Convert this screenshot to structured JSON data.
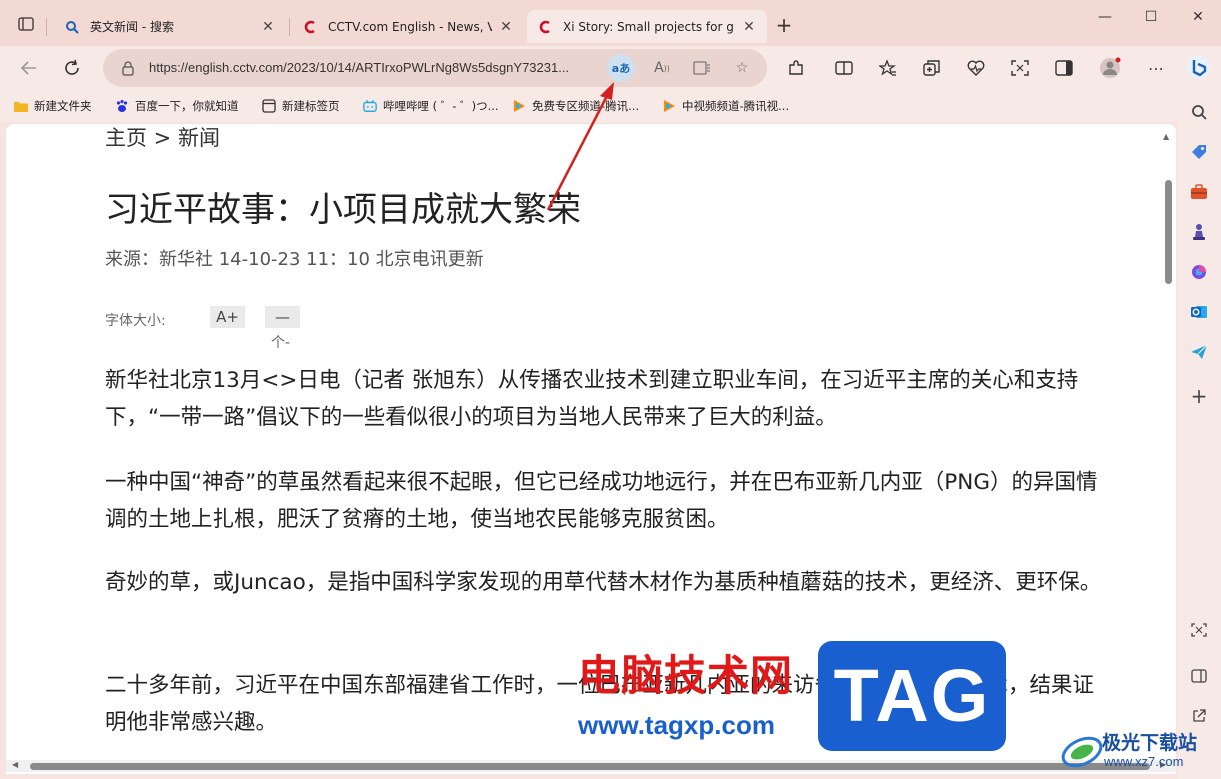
{
  "tabs": [
    {
      "title": "英文新闻 - 搜索",
      "favicon": "search-icon",
      "active": false
    },
    {
      "title": "CCTV.com English - News, Video",
      "favicon": "cctv-logo-icon",
      "active": false
    },
    {
      "title": "Xi Story: Small projects for greate",
      "favicon": "cctv-logo-icon",
      "active": true
    }
  ],
  "toolbar": {
    "url": "https://english.cctv.com/2023/10/14/ARTIrxoPWLrNg8Ws5dsgnY73231...",
    "translate_label": "aあ"
  },
  "bookmarks": [
    "新建文件夹",
    "百度一下，你就知道",
    "新建标签页",
    "哔哩哔哩 ( ゜- ゜)つ...",
    "免费专区频道-腾讯...",
    "中视频频道-腾讯视..."
  ],
  "article": {
    "breadcrumb": "主页 > 新闻",
    "title": "习近平故事：小项目成就大繁荣",
    "source": "来源：新华社 14-10-23 11：10 北京电讯更新",
    "font_size_label": "字体大小:",
    "font_increase": "A+",
    "font_decrease": "—",
    "font_hint": "个-",
    "paragraphs": [
      "新华社北京13月<>日电（记者 张旭东）从传播农业技术到建立职业车间，在习近平主席的关心和支持下，“一带一路”倡议下的一些看似很小的项目为当地人民带来了巨大的利益。",
      "一种中国“神奇”的草虽然看起来很不起眼，但它已经成功地远行，并在巴布亚新几内亚（PNG）的异国情调的土地上扎根，肥沃了贫瘠的土地，使当地农民能够克服贫困。",
      "奇妙的草，或Juncao，是指中国科学家发现的用草代替木材作为基质种植蘑菇的技术，更经济、更环保。",
      "二十多年前，习近平在中国东部福建省工作时，一位巴布亚新几内亚的来访省长介绍了军草技术，结果证明他非常感兴趣。"
    ]
  },
  "watermark": {
    "cn_text": "电脑技术网",
    "url": "www.tagxp.com",
    "tag": "TAG",
    "logo_text": "极光下载站",
    "logo_url": "www.xz7.com"
  },
  "colors": {
    "accent_arrow": "#d42020",
    "tabstrip_bg": "#f3d9d4",
    "toolbar_bg": "#f7e9e6",
    "watermark_red": "#e01818",
    "watermark_blue": "#1a5fd0"
  }
}
